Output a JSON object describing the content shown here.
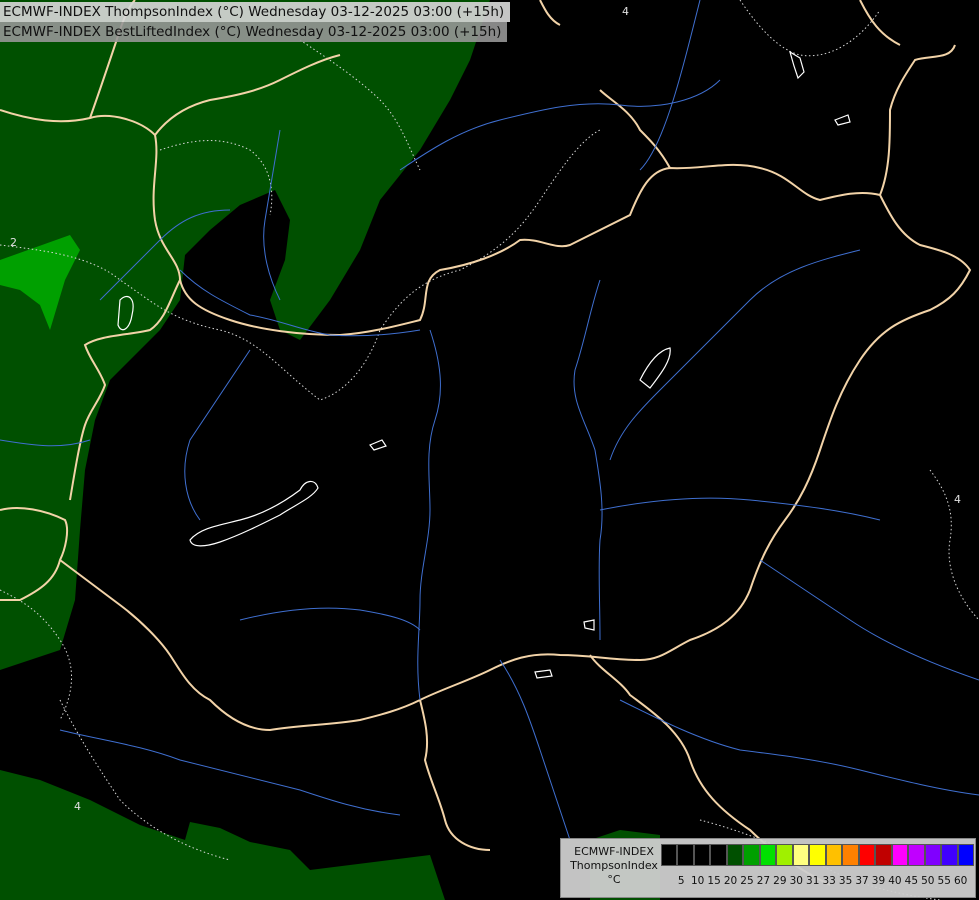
{
  "header": {
    "line1": "ECMWF-INDEX ThompsonIndex (°C) Wednesday 03-12-2025 03:00 (+15h)",
    "line2": "ECMWF-INDEX BestLiftedIndex (°C) Wednesday 03-12-2025 03:00 (+15h)"
  },
  "map": {
    "contour_labels": [
      "2",
      "4",
      "4",
      "4"
    ],
    "colors": {
      "background": "#000000",
      "dark_green_fill": "#005000",
      "bright_green_fill": "#00a000",
      "borders": "#f2d3a8",
      "rivers": "#3f6fd0",
      "contours": "#d8d8d8"
    }
  },
  "legend": {
    "title_lines": [
      "ECMWF-INDEX",
      "ThompsonIndex",
      "°C"
    ],
    "swatch_colors": [
      "#000000",
      "#000000",
      "#000000",
      "#000000",
      "#005000",
      "#00a000",
      "#00e000",
      "#a0f000",
      "#ffff80",
      "#ffff00",
      "#ffc000",
      "#ff8000",
      "#ff0000",
      "#c00000",
      "#ff00ff",
      "#c000ff",
      "#8000ff",
      "#4000ff",
      "#0000ff"
    ],
    "ticks": [
      "5",
      "10",
      "15",
      "20",
      "25",
      "27",
      "29",
      "30",
      "31",
      "33",
      "35",
      "37",
      "39",
      "40",
      "45",
      "50",
      "55",
      "60"
    ]
  }
}
